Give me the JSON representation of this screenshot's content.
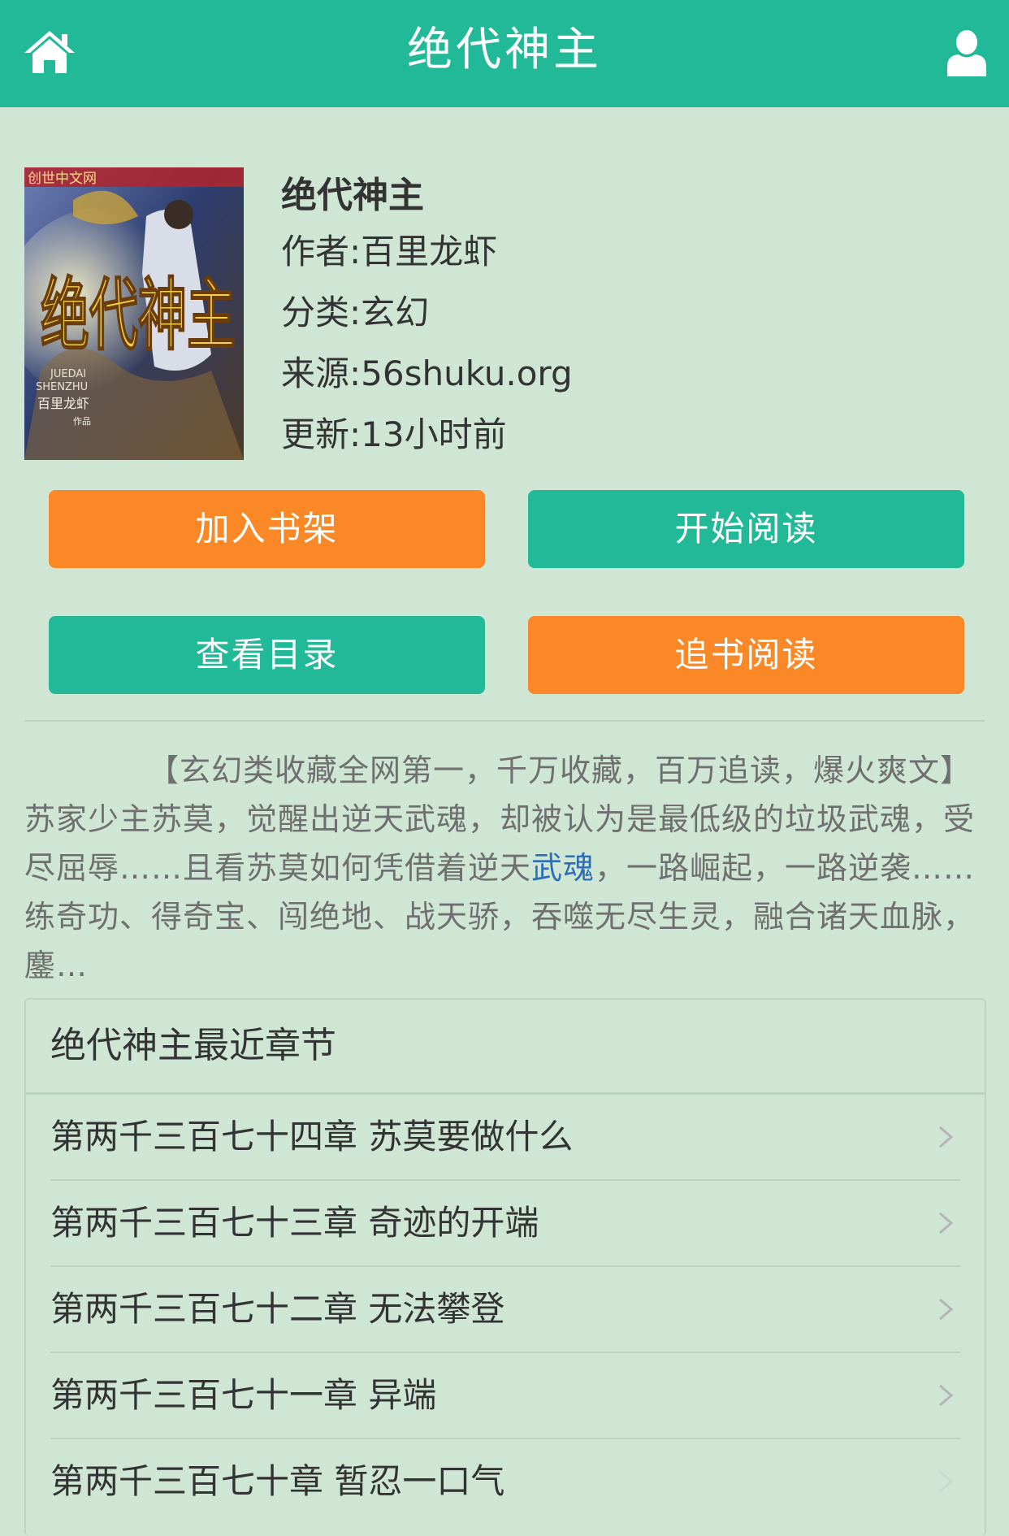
{
  "header": {
    "title": "绝代神主",
    "home_icon": "home-icon",
    "user_icon": "user-icon"
  },
  "book": {
    "title": "绝代神主",
    "author": "作者:百里龙虾",
    "category": "分类:玄幻",
    "source": "来源:56shuku.org",
    "updated": "更新:13小时前",
    "cover": {
      "logo_text": "创世中文网",
      "title_art": "绝代神主",
      "pinyin_1": "JUEDAI",
      "pinyin_2": "SHENZHU",
      "author_mark": "百里龙虾",
      "by": "作品"
    }
  },
  "actions": {
    "add_shelf": "加入书架",
    "start_read": "开始阅读",
    "view_catalog": "查看目录",
    "follow_read": "追书阅读"
  },
  "colors": {
    "primary": "#21b998",
    "accent": "#fa8826",
    "background": "#cfe6d5",
    "link": "#2d6fb7"
  },
  "description": {
    "part1": "【玄幻类收藏全网第一，千万收藏，百万追读，爆火爽文】苏家少主苏莫，觉醒出逆天武魂，却被认为是最低级的垃圾武魂，受尽屈辱……且看苏莫如何凭借着逆天",
    "highlight": "武魂",
    "part2": "，一路崛起，一路逆袭……练奇功、得奇宝、闯绝地、战天骄，吞噬无尽生灵，融合诸天血脉，鏖…"
  },
  "chapters": {
    "heading": "绝代神主最近章节",
    "items": [
      "第两千三百七十四章 苏莫要做什么",
      "第两千三百七十三章 奇迹的开端",
      "第两千三百七十二章 无法攀登",
      "第两千三百七十一章 异端",
      "第两千三百七十章 暂忍一口气"
    ]
  }
}
